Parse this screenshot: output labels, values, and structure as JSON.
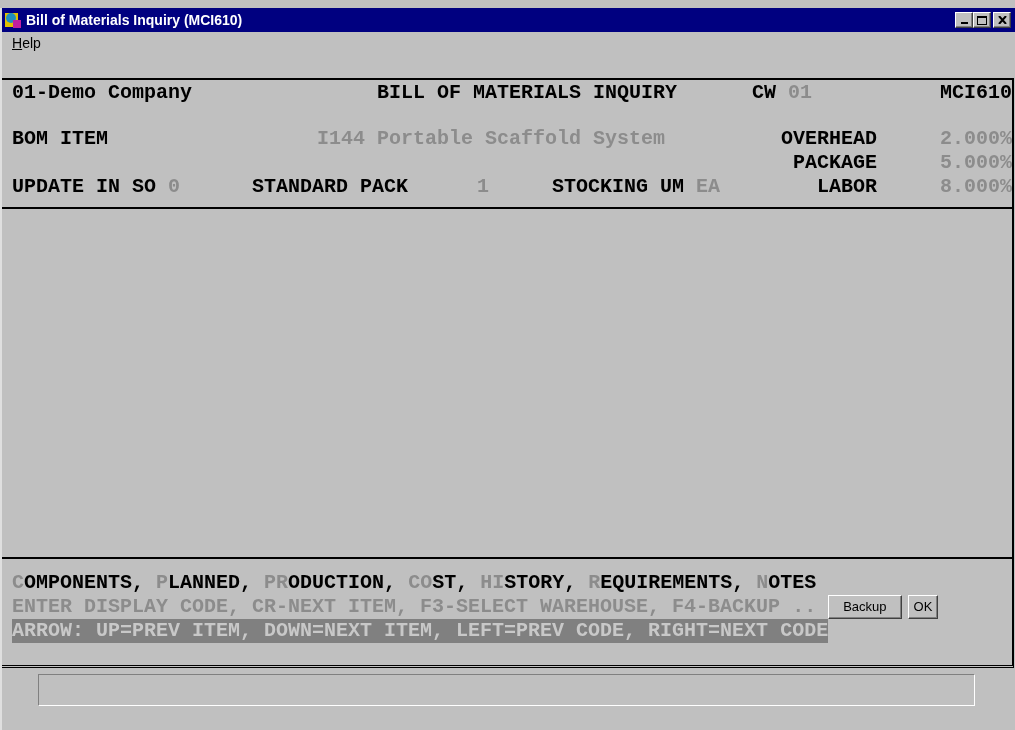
{
  "window": {
    "title": "Bill of Materials Inquiry (MCI610)"
  },
  "menu": [
    {
      "key": "H",
      "rest": "elp"
    }
  ],
  "header": {
    "company": "01-Demo Company",
    "title": "BILL OF MATERIALS INQUIRY",
    "warehouse": {
      "label": "CW",
      "value": "01"
    },
    "program": "MCI610",
    "bom_item": {
      "label": "BOM ITEM",
      "value": "I144 Portable Scaffold System"
    },
    "update_in_so": {
      "label": "UPDATE IN SO",
      "value": "0"
    },
    "standard_pack": {
      "label": "STANDARD PACK",
      "value": "1"
    },
    "stocking_um": {
      "label": "STOCKING UM",
      "value": "EA"
    },
    "rates": [
      {
        "label": "OVERHEAD",
        "value": "2.000%"
      },
      {
        "label": "PACKAGE",
        "value": "5.000%"
      },
      {
        "label": "LABOR",
        "value": "8.000%"
      }
    ]
  },
  "options": [
    {
      "key": "C",
      "rest": "OMPONENTS,"
    },
    {
      "key": "P",
      "rest": "LANNED,"
    },
    {
      "key": "PR",
      "rest": "ODUCTION,"
    },
    {
      "key": "CO",
      "rest": "ST,"
    },
    {
      "key": "HI",
      "rest": "STORY,"
    },
    {
      "key": "R",
      "rest": "EQUIREMENTS,"
    },
    {
      "key": "N",
      "rest": "OTES"
    }
  ],
  "prompt": "ENTER DISPLAY CODE, CR-NEXT ITEM, F3-SELECT WAREHOUSE, F4-BACKUP ..",
  "arrow_help": "ARROW: UP=PREV ITEM, DOWN=NEXT ITEM, LEFT=PREV CODE, RIGHT=NEXT CODE",
  "buttons": [
    "Backup",
    "OK"
  ]
}
